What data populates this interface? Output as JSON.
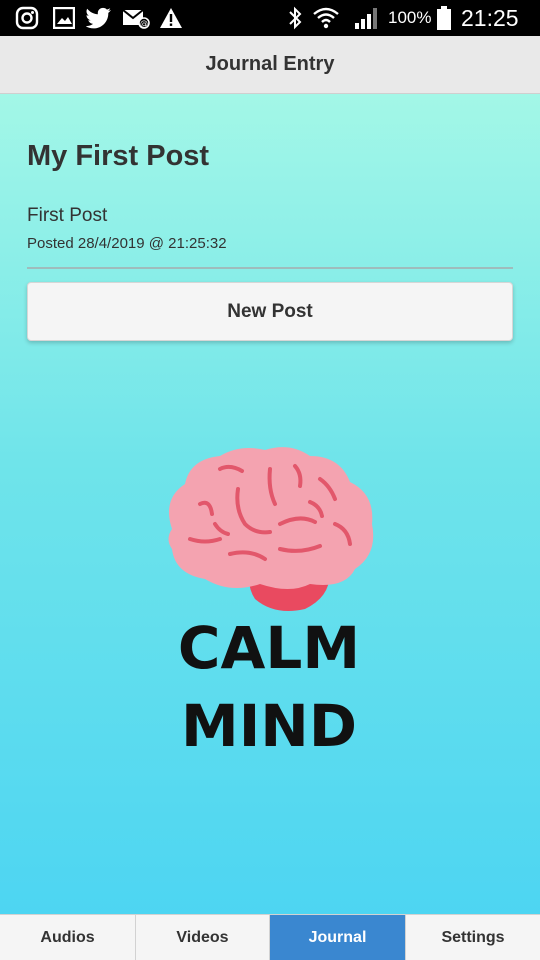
{
  "status_bar": {
    "icons_left": [
      "instagram-icon",
      "gallery-icon",
      "twitter-icon",
      "email-icon",
      "warning-icon"
    ],
    "icons_right": [
      "bluetooth-icon",
      "wifi-icon",
      "signal-icon"
    ],
    "battery": "100%",
    "time": "21:25"
  },
  "header": {
    "title": "Journal Entry"
  },
  "post": {
    "heading": "My First Post",
    "title": "First Post",
    "date": "Posted 28/4/2019 @ 21:25:32"
  },
  "new_post_button": "New Post",
  "logo": {
    "line1": "CALM",
    "line2": "MIND"
  },
  "tabs": [
    {
      "label": "Audios",
      "active": false
    },
    {
      "label": "Videos",
      "active": false
    },
    {
      "label": "Journal",
      "active": true
    },
    {
      "label": "Settings",
      "active": false
    }
  ],
  "colors": {
    "active_tab": "#3a87d0",
    "gradient_top": "#a3f7e7",
    "gradient_bottom": "#4dd5f2",
    "brain_pink": "#f4a3b0",
    "brain_lines": "#e2576b"
  }
}
